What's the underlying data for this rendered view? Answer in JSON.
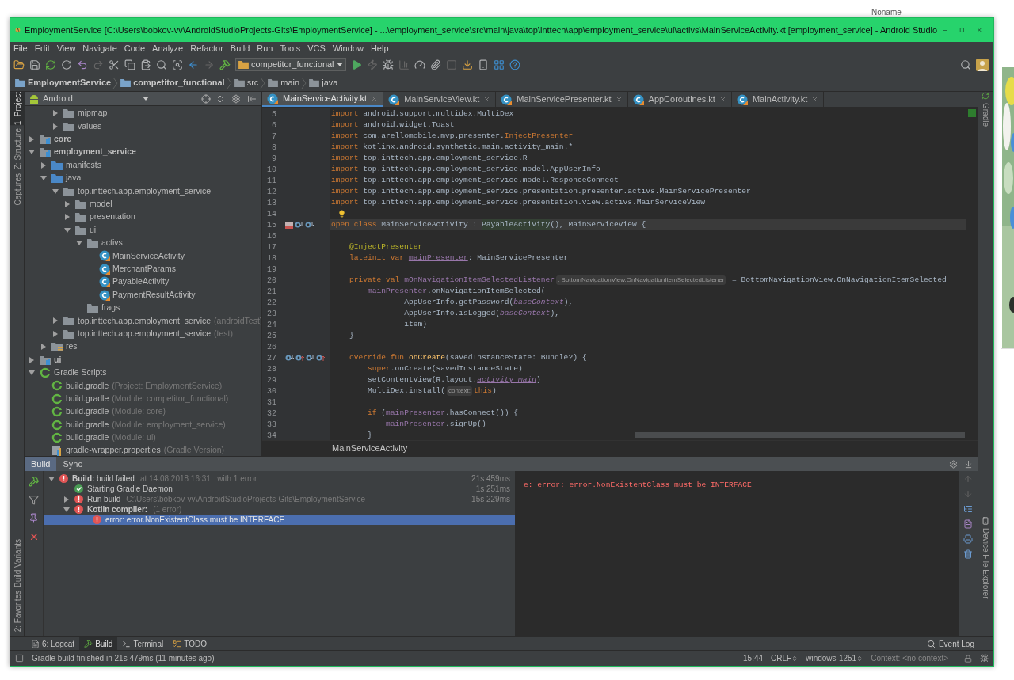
{
  "background_app": {
    "title": "Noname"
  },
  "window": {
    "title": "EmploymentService [C:\\Users\\bobkov-vv\\AndroidStudioProjects-Gits\\EmploymentService] - ...\\employment_service\\src\\main\\java\\top\\inttech\\app\\employment_service\\ui\\activs\\MainServiceActivity.kt [employment_service] - Android Studio"
  },
  "menu": [
    "File",
    "Edit",
    "View",
    "Navigate",
    "Code",
    "Analyze",
    "Refactor",
    "Build",
    "Run",
    "Tools",
    "VCS",
    "Window",
    "Help"
  ],
  "toolbar": {
    "run_config": "competitor_functional"
  },
  "breadcrumbs": [
    "EmploymentService",
    "competitor_functional",
    "src",
    "main",
    "java"
  ],
  "left_stripe": {
    "top": [
      {
        "label": "1: Project",
        "selected": true
      },
      {
        "label": "Z: Structure",
        "selected": false
      },
      {
        "label": "Captures",
        "selected": false
      }
    ],
    "bottom": [
      {
        "label": "Build Variants",
        "selected": false
      },
      {
        "label": "2: Favorites",
        "selected": false
      }
    ]
  },
  "right_stripe": {
    "top": [
      {
        "label": "Gradle",
        "selected": false
      }
    ],
    "bottom": [
      {
        "label": "Device File Explorer",
        "selected": false
      }
    ]
  },
  "project_panel": {
    "view": "Android",
    "tree": [
      {
        "children": [
          {
            "children": [
              {
                "name": "mipmap",
                "kind": "folder",
                "expanded": false
              },
              {
                "name": "values",
                "kind": "folder",
                "expanded": false
              }
            ]
          }
        ]
      },
      {
        "name": "core",
        "kind": "module",
        "expanded": false
      },
      {
        "name": "employment_service",
        "kind": "module",
        "expanded": true,
        "children": [
          {
            "name": "manifests",
            "kind": "source",
            "expanded": false
          },
          {
            "name": "java",
            "kind": "source",
            "expanded": true,
            "children": [
              {
                "name": "top.inttech.app.employment_service",
                "kind": "folder",
                "expanded": true,
                "children": [
                  {
                    "name": "model",
                    "kind": "folder",
                    "expanded": false
                  },
                  {
                    "name": "presentation",
                    "kind": "folder",
                    "expanded": false
                  },
                  {
                    "name": "ui",
                    "kind": "folder",
                    "expanded": true,
                    "children": [
                      {
                        "name": "activs",
                        "kind": "folder",
                        "expanded": true,
                        "children": [
                          {
                            "name": "MainServiceActivity",
                            "kind": "class"
                          },
                          {
                            "name": "MerchantParams",
                            "kind": "class"
                          },
                          {
                            "name": "PayableActivity",
                            "kind": "class"
                          },
                          {
                            "name": "PaymentResultActivity",
                            "kind": "class"
                          }
                        ]
                      },
                      {
                        "name": "frags",
                        "kind": "folder"
                      }
                    ]
                  }
                ]
              },
              {
                "name": "top.inttech.app.employment_service",
                "hint": "(androidTest)",
                "kind": "folder",
                "expanded": false
              },
              {
                "name": "top.inttech.app.employment_service",
                "hint": "(test)",
                "kind": "folder",
                "expanded": false
              }
            ]
          },
          {
            "name": "res",
            "kind": "res",
            "expanded": false
          }
        ]
      },
      {
        "name": "ui",
        "kind": "module",
        "expanded": false
      },
      {
        "name": "Gradle Scripts",
        "kind": "gradle",
        "expanded": true,
        "children": [
          {
            "name": "build.gradle",
            "hint": "(Project: EmploymentService)",
            "kind": "gradle"
          },
          {
            "name": "build.gradle",
            "hint": "(Module: competitor_functional)",
            "kind": "gradle"
          },
          {
            "name": "build.gradle",
            "hint": "(Module: core)",
            "kind": "gradle"
          },
          {
            "name": "build.gradle",
            "hint": "(Module: employment_service)",
            "kind": "gradle"
          },
          {
            "name": "build.gradle",
            "hint": "(Module: ui)",
            "kind": "gradle"
          },
          {
            "name": "gradle-wrapper.properties",
            "hint": "(Gradle Version)",
            "kind": "properties"
          }
        ]
      }
    ]
  },
  "editor": {
    "tabs": [
      {
        "label": "MainServiceActivity.kt",
        "selected": true
      },
      {
        "label": "MainServiceView.kt",
        "selected": false
      },
      {
        "label": "MainServicePresenter.kt",
        "selected": false
      },
      {
        "label": "AppCoroutines.kt",
        "selected": false
      },
      {
        "label": "MainActivity.kt",
        "selected": false
      }
    ],
    "lines": [
      {
        "num": "5",
        "current": false,
        "tokens": [
          {
            "t": "import ",
            "kind": "keyword"
          },
          {
            "t": "android.support.multidex.MultiDex",
            "kind": "plain"
          }
        ]
      },
      {
        "num": "6",
        "current": false,
        "tokens": [
          {
            "t": "import ",
            "kind": "keyword"
          },
          {
            "t": "android.widget.Toast",
            "kind": "plain"
          }
        ]
      },
      {
        "num": "7",
        "current": false,
        "tokens": [
          {
            "t": "import ",
            "kind": "keyword"
          },
          {
            "t": "com.arellomobile.mvp.presenter.",
            "kind": "plain"
          },
          {
            "t": "InjectPresenter",
            "kind": "keyword"
          }
        ]
      },
      {
        "num": "8",
        "current": false,
        "tokens": [
          {
            "t": "import ",
            "kind": "keyword"
          },
          {
            "t": "kotlinx.android.synthetic.main.activity_main.*",
            "kind": "plain"
          }
        ]
      },
      {
        "num": "9",
        "current": false,
        "tokens": [
          {
            "t": "import ",
            "kind": "keyword"
          },
          {
            "t": "top.inttech.app.employment_service.R",
            "kind": "plain"
          }
        ]
      },
      {
        "num": "10",
        "current": false,
        "tokens": [
          {
            "t": "import ",
            "kind": "keyword"
          },
          {
            "t": "top.inttech.app.employment_service.model.AppUserInfo",
            "kind": "plain"
          }
        ]
      },
      {
        "num": "11",
        "current": false,
        "tokens": [
          {
            "t": "import ",
            "kind": "keyword"
          },
          {
            "t": "top.inttech.app.employment_service.model.ResponceConnect",
            "kind": "plain"
          }
        ]
      },
      {
        "num": "12",
        "current": false,
        "tokens": [
          {
            "t": "import ",
            "kind": "keyword"
          },
          {
            "t": "top.inttech.app.employment_service.presentation.presenter.activs.MainServicePresenter",
            "kind": "plain"
          }
        ]
      },
      {
        "num": "13",
        "current": false,
        "tokens": [
          {
            "t": "import ",
            "kind": "keyword"
          },
          {
            "t": "top.inttech.app.employment_service.presentation.view.activs.MainServiceView",
            "kind": "plain"
          }
        ]
      },
      {
        "num": "14",
        "current": false,
        "bulb": true
      },
      {
        "num": "15",
        "current": true,
        "gutter": [
          {
            "kind": "class"
          },
          {
            "kind": "down"
          },
          {
            "kind": "down"
          }
        ],
        "tokens": [
          {
            "t": "open class ",
            "kind": "keyword"
          },
          {
            "t": "MainServiceActivity : ",
            "kind": "plain"
          },
          {
            "t": "PayableActivity",
            "kind": "superclass"
          },
          {
            "t": "(), MainServiceView {",
            "kind": "plain"
          }
        ]
      },
      {
        "num": "16",
        "current": false
      },
      {
        "num": "17",
        "current": false,
        "tokens": [
          {
            "t": "    @InjectPresenter",
            "kind": "annotation"
          }
        ]
      },
      {
        "num": "18",
        "current": false,
        "tokens": [
          {
            "t": "    lateinit var ",
            "kind": "keyword"
          },
          {
            "t": "mainPresenter",
            "kind": "field"
          },
          {
            "t": ": MainServicePresenter",
            "kind": "plain"
          }
        ]
      },
      {
        "num": "19",
        "current": false
      },
      {
        "num": "20",
        "current": false,
        "tokens": [
          {
            "t": "    private val ",
            "kind": "keyword"
          },
          {
            "t": "mOnNavigationItemSelectedListener",
            "kind": "property"
          },
          {
            "t": ": BottomNavigationView.OnNavigationItemSelectedListener",
            "kind": "hint"
          },
          {
            "t": " = BottomNavigationView.OnNavigationItemSelected",
            "kind": "plain"
          }
        ]
      },
      {
        "num": "21",
        "current": false,
        "tokens": [
          {
            "t": "        mainPresenter",
            "kind": "field"
          },
          {
            "t": ".onNavigationItemSelected(",
            "kind": "plain"
          }
        ]
      },
      {
        "num": "22",
        "current": false,
        "tokens": [
          {
            "t": "                AppUserInfo.getPassword(",
            "kind": "plain"
          },
          {
            "t": "baseContext",
            "kind": "italic"
          },
          {
            "t": "),",
            "kind": "plain"
          }
        ]
      },
      {
        "num": "23",
        "current": false,
        "tokens": [
          {
            "t": "                AppUserInfo.isLogged(",
            "kind": "plain"
          },
          {
            "t": "baseContext",
            "kind": "italic"
          },
          {
            "t": "),",
            "kind": "plain"
          }
        ]
      },
      {
        "num": "24",
        "current": false,
        "tokens": [
          {
            "t": "                item)",
            "kind": "plain"
          }
        ]
      },
      {
        "num": "25",
        "current": false,
        "tokens": [
          {
            "t": "    }",
            "kind": "plain"
          }
        ]
      },
      {
        "num": "26",
        "current": false
      },
      {
        "num": "27",
        "current": false,
        "gutter": [
          {
            "kind": "down"
          },
          {
            "kind": "up"
          },
          {
            "kind": "down"
          },
          {
            "kind": "up"
          }
        ],
        "tokens": [
          {
            "t": "    override fun ",
            "kind": "keyword"
          },
          {
            "t": "onCreate",
            "kind": "function"
          },
          {
            "t": "(savedInstanceState: Bundle?) {",
            "kind": "plain"
          }
        ]
      },
      {
        "num": "28",
        "current": false,
        "tokens": [
          {
            "t": "        super",
            "kind": "keyword"
          },
          {
            "t": ".onCreate(savedInstanceState)",
            "kind": "plain"
          }
        ]
      },
      {
        "num": "29",
        "current": false,
        "tokens": [
          {
            "t": "        setContentView(R.layout.",
            "kind": "plain"
          },
          {
            "t": "activity_main",
            "kind": "resource"
          },
          {
            "t": ")",
            "kind": "plain"
          }
        ]
      },
      {
        "num": "30",
        "current": false,
        "tokens": [
          {
            "t": "        MultiDex.install(",
            "kind": "plain"
          },
          {
            "t": "context:",
            "kind": "hint"
          },
          {
            "t": "this",
            "kind": "keyword"
          },
          {
            "t": ")",
            "kind": "plain"
          }
        ]
      },
      {
        "num": "31",
        "current": false
      },
      {
        "num": "32",
        "current": false,
        "tokens": [
          {
            "t": "        if",
            "kind": "keyword"
          },
          {
            "t": " (",
            "kind": "plain"
          },
          {
            "t": "mainPresenter",
            "kind": "field"
          },
          {
            "t": ".hasConnect()) {",
            "kind": "plain"
          }
        ]
      },
      {
        "num": "33",
        "current": false,
        "tokens": [
          {
            "t": "            mainPresenter",
            "kind": "field"
          },
          {
            "t": ".signUp()",
            "kind": "plain"
          }
        ]
      },
      {
        "num": "34",
        "current": false,
        "tokens": [
          {
            "t": "        }",
            "kind": "plain"
          }
        ]
      }
    ],
    "breadcrumb": "MainServiceActivity"
  },
  "build_panel": {
    "tabs": [
      {
        "label": "Build",
        "selected": true
      },
      {
        "label": "Sync",
        "selected": false
      }
    ],
    "tree": [
      {
        "label": "**Build:** build failed",
        "kind": "root",
        "status": {
          "kind": "error"
        },
        "hint": "at 14.08.2018 16:31   with 1 error",
        "time": "21s 459ms",
        "expanded": true,
        "selected": false,
        "children": [
          {
            "label": "Starting Gradle Daemon",
            "kind": "task",
            "status": {
              "kind": "ok"
            },
            "time": "1s 251ms",
            "selected": false
          },
          {
            "label": "Run build",
            "kind": "task",
            "status": {
              "kind": "error"
            },
            "hint": "C:\\Users\\bobkov-vv\\AndroidStudioProjects-Gits\\EmploymentService",
            "time": "15s 229ms",
            "expanded": false,
            "selected": false
          },
          {
            "label": "Kotlin compiler:",
            "kind": "group",
            "status": {
              "kind": "error"
            },
            "hint": "(1 error)",
            "expanded": true,
            "selected": false,
            "children": [
              {
                "label": "error: error.NonExistentClass must be INTERFACE",
                "kind": "message",
                "status": {
                  "kind": "error"
                },
                "selected": true
              }
            ]
          }
        ]
      }
    ],
    "console": "e: error: error.NonExistentClass must be INTERFACE"
  },
  "bottom_tabs": [
    {
      "label": "6: Logcat",
      "kind": "logcat",
      "selected": false
    },
    {
      "label": "Build",
      "kind": "build",
      "selected": true
    },
    {
      "label": "Terminal",
      "kind": "terminal",
      "selected": false
    },
    {
      "label": "TODO",
      "kind": "todo",
      "selected": false
    }
  ],
  "event_log": "Event Log",
  "status_bar": {
    "message": "Gradle build finished in 21s 479ms (11 minutes ago)",
    "position": "15:44",
    "line_separator": "CRLF",
    "encoding": "windows-1251",
    "context": "Context: <no context>"
  }
}
